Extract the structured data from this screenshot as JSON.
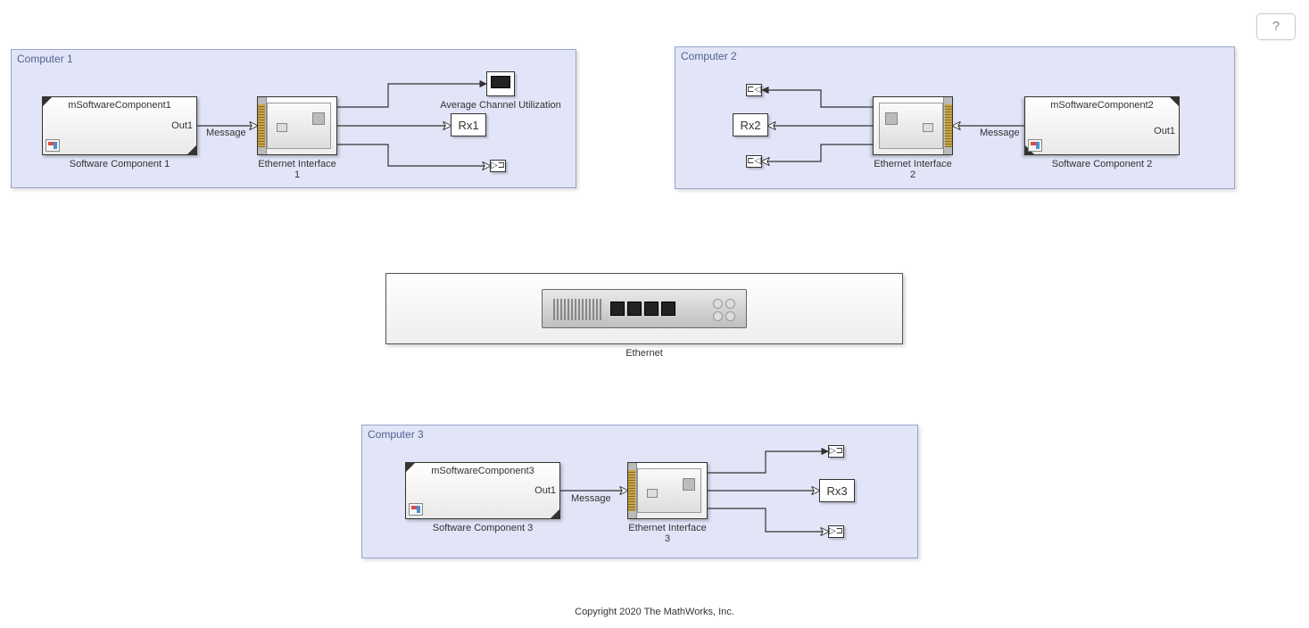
{
  "help_button": "?",
  "copyright": "Copyright 2020 The MathWorks, Inc.",
  "areas": {
    "c1": {
      "title": "Computer 1"
    },
    "c2": {
      "title": "Computer 2"
    },
    "c3": {
      "title": "Computer 3"
    }
  },
  "blocks": {
    "sw1": {
      "name": "mSoftwareComponent1",
      "port": "Out1",
      "label": "Software Component 1"
    },
    "sw2": {
      "name": "mSoftwareComponent2",
      "port": "Out1",
      "label": "Software Component 2"
    },
    "sw3": {
      "name": "mSoftwareComponent3",
      "port": "Out1",
      "label": "Software Component 3"
    },
    "eth1": {
      "label": "Ethernet Interface 1"
    },
    "eth2": {
      "label": "Ethernet Interface 2"
    },
    "eth3": {
      "label": "Ethernet Interface 3"
    },
    "scope": {
      "label": "Average Channel Utilization"
    },
    "rx1": {
      "text": "Rx1"
    },
    "rx2": {
      "text": "Rx2"
    },
    "rx3": {
      "text": "Rx3"
    },
    "switch": {
      "label": "Ethernet"
    }
  },
  "signals": {
    "msg1": "Message",
    "msg2": "Message",
    "msg3": "Message"
  }
}
